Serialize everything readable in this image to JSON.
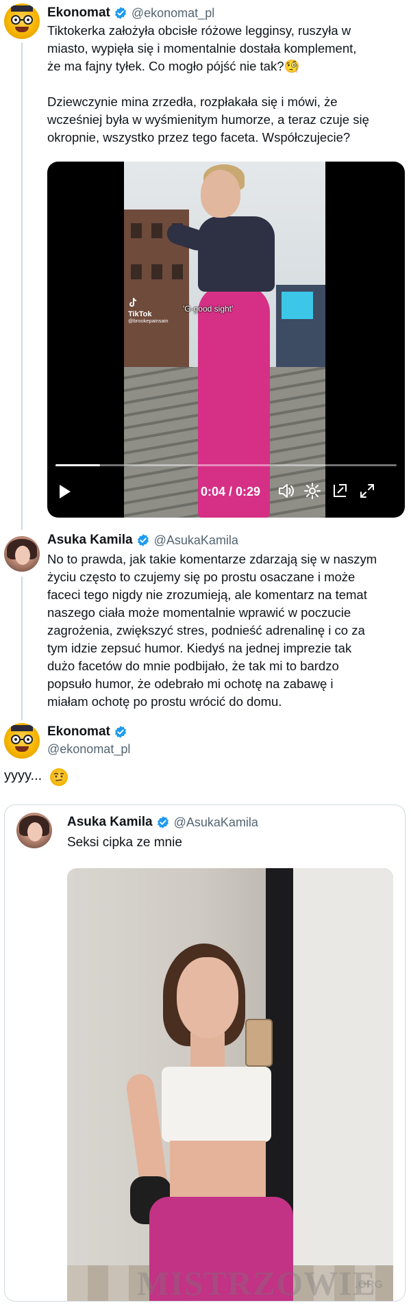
{
  "tweets": [
    {
      "display_name": "Ekonomat",
      "handle": "@ekonomat_pl",
      "text": "Tiktokerka założyła obcisłe różowe legginsy, ruszyła w\nmiasto, wypięła się i momentalnie dostała komplement,\nże ma fajny tyłek. Co mogło pójść nie tak?🧐\n\nDziewczynie mina zrzedła, rozpłakała się i mówi, że\nwcześniej była w wyśmienitym humorze, a teraz czuje się\nokropnie, wszystko przez tego faceta. Współczujecie?",
      "video": {
        "tiktok_label": "TikTok",
        "tiktok_user": "@brookepainsain",
        "caption": "'G-good sight'",
        "time": "0:04 / 0:29",
        "progress": 0.13
      }
    },
    {
      "display_name": "Asuka Kamila",
      "handle": "@AsukaKamila",
      "text": "No to prawda, jak takie komentarze zdarzają się w naszym\nżyciu często to czujemy się po prostu osaczane i może\nfaceci tego nigdy nie zrozumieją, ale komentarz na temat\nnaszego ciała może momentalnie wprawić w poczucie\nzagrożenia, zwiększyć stres, podnieść adrenalinę i co za\ntym idzie zepsuć humor. Kiedyś na jednej imprezie tak\ndużo facetów do mnie podbijało, że tak mi to bardzo\npopsuło humor, że odebrało mi ochotę na zabawę i\nmiałam ochotę po prostu wrócić do domu."
    },
    {
      "display_name": "Ekonomat",
      "handle": "@ekonomat_pl",
      "text": "yyyy...",
      "emoji": "raised-eyebrow"
    }
  ],
  "quote": {
    "display_name": "Asuka Kamila",
    "handle": "@AsukaKamila",
    "text": "Seksi cipka ze mnie"
  },
  "watermark": {
    "text": "MISTRZOWIE",
    "suffix": ".ORG"
  },
  "colors": {
    "verified": "#1d9bf0",
    "text": "#0f1419",
    "secondary": "#536471",
    "border": "#cfd9de"
  },
  "icons": [
    "verified-badge-icon",
    "play-icon",
    "volume-icon",
    "settings-gear-icon",
    "minimize-icon",
    "fullscreen-icon"
  ]
}
